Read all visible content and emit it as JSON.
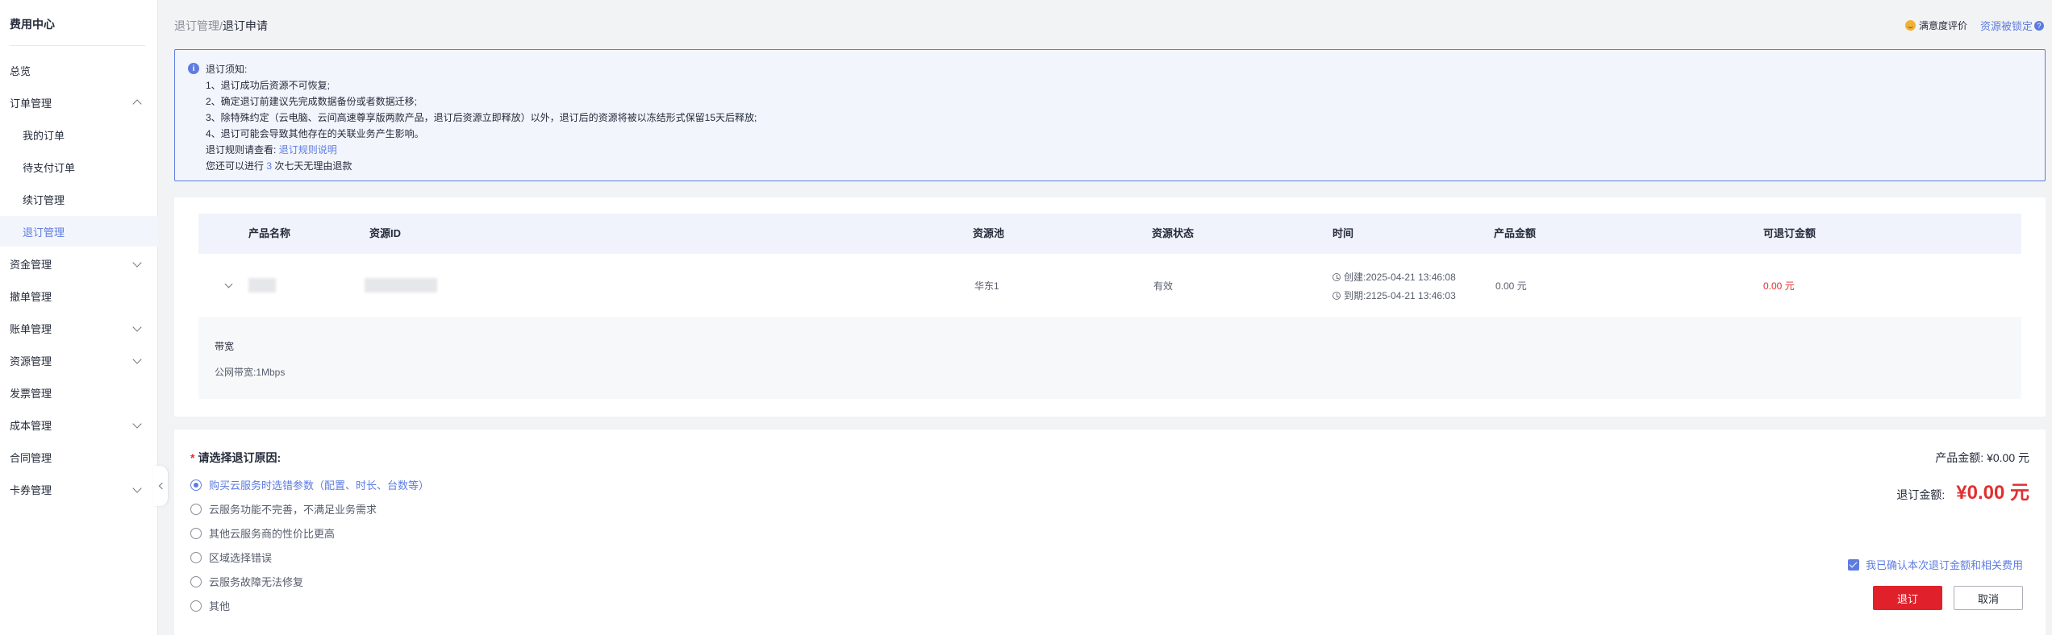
{
  "sidebar": {
    "title": "费用中心",
    "items": [
      {
        "label": "总览"
      },
      {
        "label": "订单管理"
      },
      {
        "label": "我的订单"
      },
      {
        "label": "待支付订单"
      },
      {
        "label": "续订管理"
      },
      {
        "label": "退订管理"
      },
      {
        "label": "资金管理"
      },
      {
        "label": "撤单管理"
      },
      {
        "label": "账单管理"
      },
      {
        "label": "资源管理"
      },
      {
        "label": "发票管理"
      },
      {
        "label": "成本管理"
      },
      {
        "label": "合同管理"
      },
      {
        "label": "卡券管理"
      }
    ]
  },
  "header": {
    "breadcrumb_parent": "退订管理",
    "breadcrumb_sep": "/",
    "breadcrumb_current": "退订申请",
    "satisfaction": "满意度评价",
    "locked": "资源被锁定",
    "help_glyph": "?"
  },
  "notice": {
    "icon_glyph": "i",
    "title": "退订须知:",
    "lines": [
      "1、退订成功后资源不可恢复;",
      "2、确定退订前建议先完成数据备份或者数据迁移;",
      "3、除特殊约定（云电脑、云间高速尊享版两款产品，退订后资源立即释放）以外，退订后的资源将被以冻结形式保留15天后释放;",
      "4、退订可能会导致其他存在的关联业务产生影响。"
    ],
    "rules_prefix": "退订规则请查看:",
    "rules_link": "退订规则说明",
    "count_prefix": "您还可以进行",
    "count_value": "3",
    "count_suffix": "次七天无理由退款"
  },
  "table": {
    "headers": [
      "产品名称",
      "资源ID",
      "资源池",
      "资源状态",
      "时间",
      "产品金额",
      "可退订金额"
    ],
    "row": {
      "pool": "华东1",
      "status": "有效",
      "created": "创建:2025-04-21 13:46:08",
      "expires": "到期:2125-04-21 13:46:03",
      "amount": "0.00 元",
      "refundable": "0.00 元"
    },
    "detail": {
      "title": "带宽",
      "value": "公网带宽:1Mbps"
    }
  },
  "form": {
    "required_mark": "*",
    "reason_title": "请选择退订原因:",
    "reasons": [
      "购买云服务时选错参数（配置、时长、台数等）",
      "云服务功能不完善，不满足业务需求",
      "其他云服务商的性价比更高",
      "区域选择错误",
      "云服务故障无法修复",
      "其他"
    ],
    "selected_index": 0,
    "product_amount": "产品金额: ¥0.00 元",
    "refund_label": "退订金额:",
    "refund_value": "¥0.00 元",
    "confirm_label": "我已确认本次退订金额和相关费用",
    "submit_label": "退订",
    "cancel_label": "取消"
  },
  "colors": {
    "accent": "#5e7ce0",
    "danger": "#e0212b"
  }
}
